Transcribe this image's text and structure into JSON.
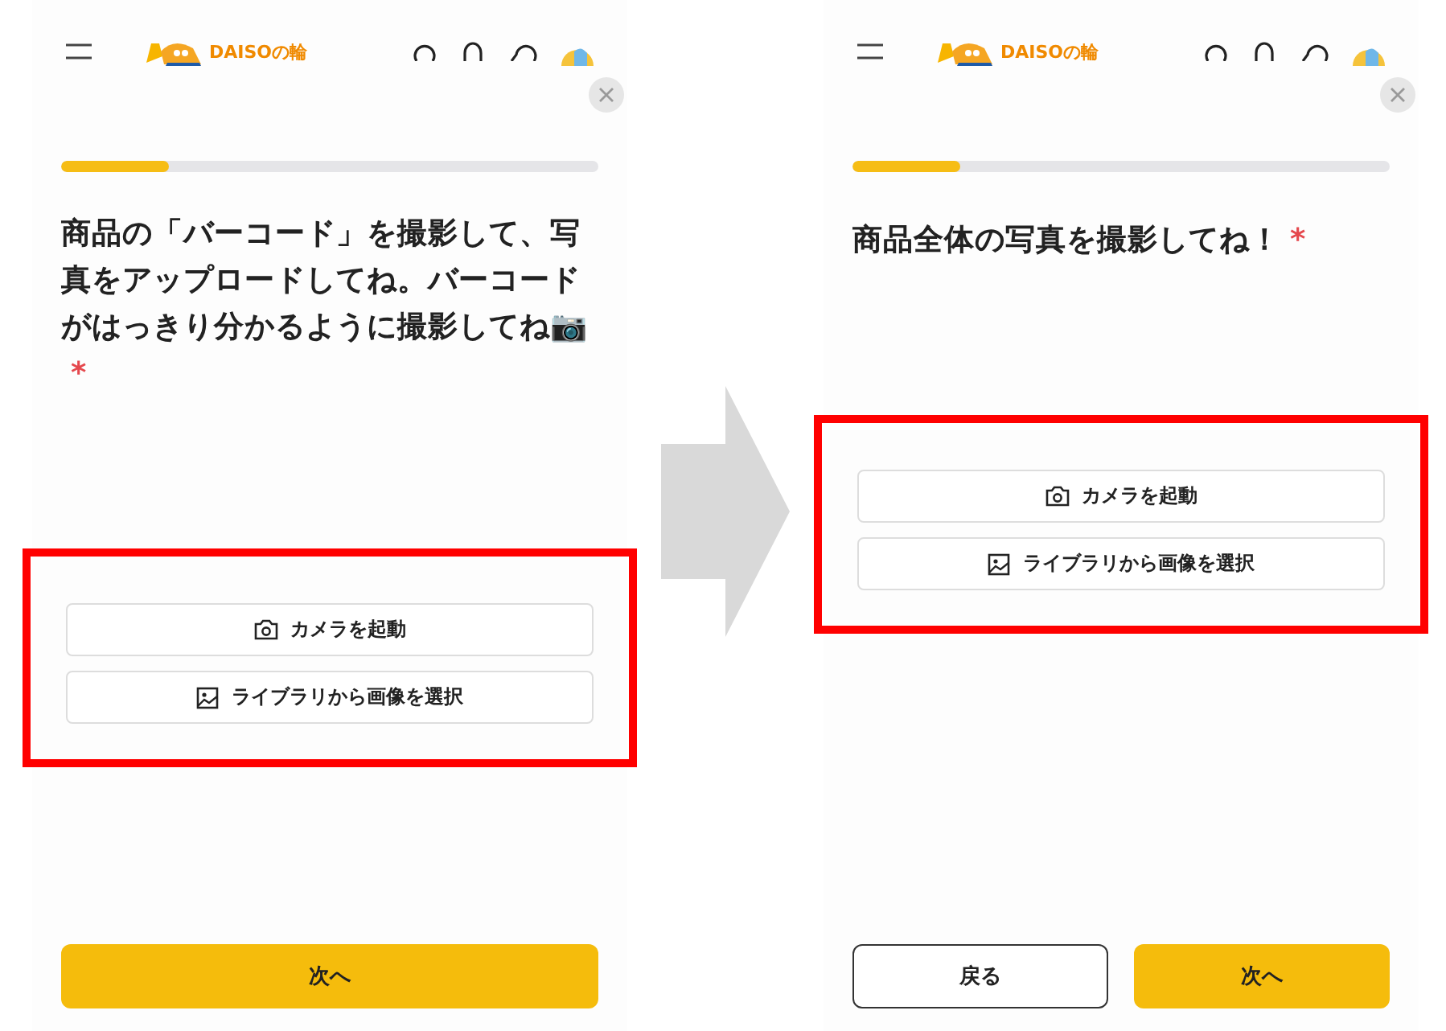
{
  "screens": [
    {
      "logo_text": "DAISOの輪",
      "progress": {
        "level": 0.2
      },
      "question": "商品の「バーコード」を撮影して、写真をアップロードしてね。バーコードがはっきり分かるように撮影してね📷",
      "required_mark": "*",
      "highlighted": true,
      "options": [
        {
          "kind": "camera",
          "label": "カメラを起動"
        },
        {
          "kind": "library",
          "label": "ライブラリから画像を選択"
        }
      ],
      "nav": [
        {
          "kind": "primary",
          "label": "次へ"
        }
      ]
    },
    {
      "logo_text": "DAISOの輪",
      "progress": {
        "level": 0.2
      },
      "question": "商品全体の写真を撮影してね！",
      "required_mark": "*",
      "highlighted": true,
      "options": [
        {
          "kind": "camera",
          "label": "カメラを起動"
        },
        {
          "kind": "library",
          "label": "ライブラリから画像を選択"
        }
      ],
      "nav": [
        {
          "kind": "secondary",
          "label": "戻る"
        },
        {
          "kind": "primary",
          "label": "次へ"
        }
      ]
    }
  ]
}
